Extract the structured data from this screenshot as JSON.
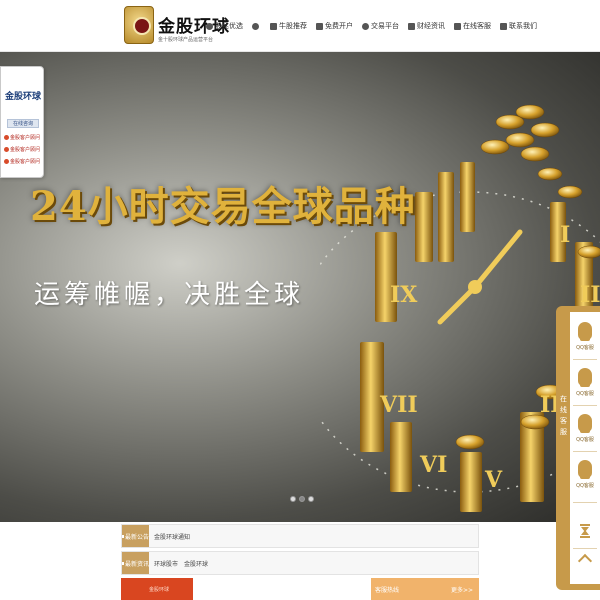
{
  "brand": {
    "name": "金股环球",
    "tagline": "金十股环球产品运营平台"
  },
  "nav": {
    "items": [
      {
        "label": "股民优选",
        "icon": "user-icon"
      },
      {
        "label": "",
        "icon": "globe-icon"
      },
      {
        "label": "牛股推荐",
        "icon": "chart-icon"
      },
      {
        "label": "免费开户",
        "icon": "account-icon"
      },
      {
        "label": "交易平台",
        "icon": "platform-icon"
      },
      {
        "label": "财经资讯",
        "icon": "news-icon"
      },
      {
        "label": "在线客服",
        "icon": "chat-icon"
      },
      {
        "label": "联系我们",
        "icon": "phone-icon"
      }
    ]
  },
  "banner": {
    "headline": "24小时交易全球品种",
    "subline": "运筹帷幄，决胜全球",
    "slides": 3,
    "active_slide": 2
  },
  "left_panel": {
    "title": "金股环球",
    "subtitle": "在线咨询",
    "lines": [
      "金股客户顾问",
      "金股客户顾问",
      "金股客户顾问"
    ]
  },
  "right_panel": {
    "vertical_label": "在线客服",
    "qq_items": [
      "QQ客服",
      "QQ客服",
      "QQ客服",
      "QQ客服"
    ]
  },
  "info_rows": [
    {
      "tag": "最新公告",
      "texts": [
        "金股环球通知"
      ]
    },
    {
      "tag": "最新资讯",
      "texts": [
        "环球股市",
        "金股环球"
      ]
    }
  ],
  "bottom": {
    "left_text": "金股环球",
    "right_title": "客服热线",
    "right_more": "更多>>"
  },
  "colors": {
    "gold": "#c79a4a",
    "headline_gold": "#e0b23c",
    "orange": "#d94620"
  }
}
